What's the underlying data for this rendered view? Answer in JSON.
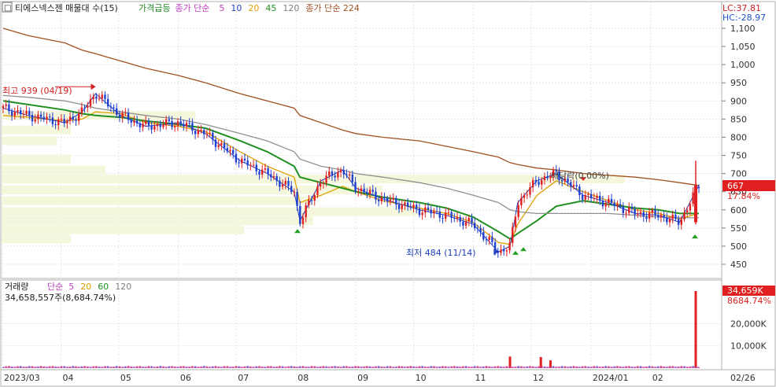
{
  "chart_data": [
    {
      "type": "candlestick",
      "title": "티에스넥스젠 매물대 수(15)",
      "indicators": [
        {
          "label": "가격급등",
          "color": "#228822"
        },
        {
          "label": "종가 단순",
          "color": "#c040c0"
        },
        {
          "label": "5",
          "color": "#c040c0"
        },
        {
          "label": "10",
          "color": "#2040c0"
        },
        {
          "label": "20",
          "color": "#e0a000"
        },
        {
          "label": "45",
          "color": "#209020"
        },
        {
          "label": "120",
          "color": "#808080"
        },
        {
          "label": "종가 단순 224",
          "color": "#a05020"
        }
      ],
      "ylim": [
        420,
        1160
      ],
      "y_ticks": [
        "1,100",
        "1,050",
        "1,000",
        "950",
        "900",
        "850",
        "800",
        "750",
        "700",
        "650",
        "600",
        "550",
        "500",
        "450"
      ],
      "x_ticks": [
        "2023/03",
        "04",
        "05",
        "06",
        "07",
        "08",
        "09",
        "10",
        "11",
        "12",
        "2024/01",
        "02",
        "02/26"
      ],
      "lc_label": "LC:37.81",
      "hc_label": "HC:-28.97",
      "current_price": "667",
      "current_change": "17.84%",
      "annotations": {
        "high": "최고 939 (04/19)",
        "low": "최저 484 (11/14)",
        "dividend": "배당락(0.00%)"
      },
      "series": [
        {
          "name": "price",
          "type": "candlestick",
          "x": [
            "2023-03-02",
            "2023-03-15",
            "2023-04-03",
            "2023-04-12",
            "2023-04-19",
            "2023-05-02",
            "2023-05-15",
            "2023-06-01",
            "2023-06-15",
            "2023-07-03",
            "2023-07-17",
            "2023-07-31",
            "2023-08-03",
            "2023-08-14",
            "2023-08-25",
            "2023-09-01",
            "2023-09-15",
            "2023-10-04",
            "2023-10-18",
            "2023-11-01",
            "2023-11-14",
            "2023-11-20",
            "2023-11-24",
            "2023-12-04",
            "2023-12-14",
            "2023-12-28",
            "2024-01-10",
            "2024-01-24",
            "2024-02-05",
            "2024-02-16",
            "2024-02-26"
          ],
          "close": [
            880,
            860,
            840,
            870,
            920,
            860,
            830,
            840,
            810,
            735,
            700,
            650,
            570,
            680,
            710,
            660,
            630,
            600,
            585,
            560,
            484,
            500,
            620,
            680,
            700,
            640,
            620,
            590,
            585,
            566,
            667
          ]
        },
        {
          "name": "5",
          "values_approx": "follows price"
        },
        {
          "name": "20",
          "values": [
            860,
            855,
            845,
            850,
            870,
            865,
            840,
            830,
            815,
            760,
            720,
            690,
            620,
            640,
            665,
            650,
            625,
            605,
            590,
            565,
            510,
            505,
            560,
            640,
            680,
            650,
            625,
            600,
            590,
            575,
            590
          ]
        },
        {
          "name": "45",
          "values": [
            900,
            890,
            875,
            865,
            860,
            855,
            845,
            835,
            825,
            790,
            760,
            720,
            690,
            675,
            660,
            650,
            635,
            620,
            605,
            580,
            540,
            520,
            535,
            570,
            610,
            625,
            615,
            605,
            600,
            590,
            590
          ]
        },
        {
          "name": "120",
          "values": [
            915,
            910,
            900,
            890,
            880,
            870,
            860,
            850,
            835,
            810,
            790,
            760,
            740,
            720,
            710,
            700,
            690,
            675,
            660,
            640,
            620,
            600,
            595,
            590,
            590,
            590,
            590,
            585,
            580,
            578,
            578
          ]
        },
        {
          "name": "224",
          "values": [
            1100,
            1080,
            1060,
            1040,
            1030,
            1010,
            990,
            970,
            950,
            920,
            900,
            880,
            860,
            840,
            820,
            810,
            800,
            790,
            775,
            760,
            745,
            730,
            725,
            715,
            710,
            700,
            695,
            690,
            683,
            675,
            667
          ]
        }
      ],
      "volume_profile": {
        "bins_approx": [
          {
            "price": 860,
            "vol": 0.28
          },
          {
            "price": 820,
            "vol": 0.1
          },
          {
            "price": 790,
            "vol": 0.08
          },
          {
            "price": 740,
            "vol": 0.1
          },
          {
            "price": 710,
            "vol": 0.15
          },
          {
            "price": 685,
            "vol": 0.9
          },
          {
            "price": 655,
            "vol": 0.55
          },
          {
            "price": 625,
            "vol": 0.45
          },
          {
            "price": 595,
            "vol": 0.6
          },
          {
            "price": 570,
            "vol": 0.45
          },
          {
            "price": 545,
            "vol": 0.35
          },
          {
            "price": 520,
            "vol": 0.1
          }
        ]
      }
    },
    {
      "type": "bar",
      "title": "거래량",
      "indicators": [
        {
          "label": "단순",
          "color": "#c040c0"
        },
        {
          "label": "5",
          "color": "#c040c0"
        },
        {
          "label": "20",
          "color": "#e0a000"
        },
        {
          "label": "60",
          "color": "#209020"
        },
        {
          "label": "120",
          "color": "#808080"
        }
      ],
      "value_label": "34,658,557주(8,684.74%)",
      "ylim": [
        0,
        36000
      ],
      "y_ticks": [
        "20,000K",
        "10,000K"
      ],
      "current_volume": "34,659K",
      "current_volume_pct": "8684.74%",
      "spikes": [
        {
          "x": "2023-11-20",
          "value": 5200
        },
        {
          "x": "2023-12-06",
          "value": 5000
        },
        {
          "x": "2023-12-11",
          "value": 3500
        },
        {
          "x": "2024-02-26",
          "value": 34659
        }
      ]
    }
  ]
}
